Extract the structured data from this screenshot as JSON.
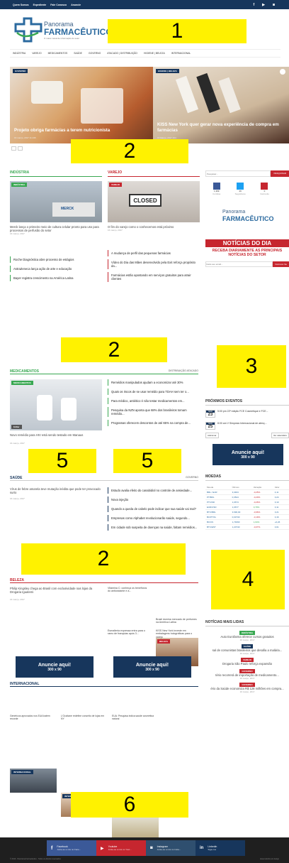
{
  "topbar": {
    "links": [
      "Quem Somos",
      "Expediente",
      "Fale Conosco",
      "Anuncie"
    ]
  },
  "logo": {
    "line1": "Panorama",
    "line2": "FARMACÊUTICO",
    "sub": "O maior canal de informação do setor"
  },
  "callouts": {
    "c1": "1",
    "c2a": "2",
    "c2b": "2",
    "c2c": "2",
    "c3": "3",
    "c4": "4",
    "c5a": "5",
    "c5b": "5",
    "c6": "6"
  },
  "nav": [
    "INDÚSTRIA",
    "VAREJO",
    "MEDICAMENTOS",
    "SAÚDE",
    "GOVERNO",
    "ATACADO | DISTRIBUIÇÃO",
    "HIGIENE | BELEZA",
    "INTERNACIONAL"
  ],
  "hero": {
    "left": {
      "tag": "GOVERNO",
      "title": "Projeto obriga farmácias a terem nutricionista",
      "meta": "16 março, 2017  11.136"
    },
    "right": {
      "tag": "HIGIENE | BELEZA",
      "title": "KISS New York quer gerar nova experiência de compra em farmácias",
      "meta": "15 Março, 2017  404"
    }
  },
  "industria": {
    "title": "INDÚSTRIA",
    "tag": "INDÚSTRIA",
    "img_label": "MERCK",
    "lead": "Merck lança o primeiro meio de cultura celular pronto para uso para processos de perfusão do setor",
    "date": "16 março, 2017",
    "list": [
      "Roche Diagnóstica abre processo de estágios",
      "AstraZeneca lança ação de arte e educação",
      "Bayer registra crescimento na América Latina"
    ]
  },
  "varejo": {
    "title": "VAREJO",
    "tag": "VAREJO",
    "img_label": "CLOSED",
    "lead": "O fim do varejo como o conhecemos está próximo",
    "date": "16 março, 2017",
    "list": [
      "A mudança de perfil das pequenas farmácias",
      "Vídeo do Dia das Mães desenvolvido pela Exit reforça propósito da...",
      "Farmácias estão apostando em serviços gratuitos para atrair clientes"
    ]
  },
  "sidebar": {
    "search_placeholder": "Pesquisar...",
    "search_btn": "PESQUISAR",
    "counts": [
      {
        "n": "1,369",
        "l": "Curtidas"
      },
      {
        "n": "29",
        "l": "Seguidores"
      },
      {
        "n": "0",
        "l": "Inscrevâs"
      }
    ],
    "news_title": "NOTÍCIAS DO DIA",
    "news_sub": "RECEBA DIARIAMENTE AS PRINCIPAIS NOTÍCIAS DO SETOR",
    "email_placeholder": "Insira seu email...",
    "subscribe": "Inscrever-Se"
  },
  "medicamentos": {
    "title": "MEDICAMENTOS",
    "filters": [
      "DISTRIBUIÇÃO",
      "ATACADO"
    ],
    "tag": "MEDICAMENTOS",
    "edit": "Editar",
    "lead": "Novo remédio para HIV está sendo testado em Manaus",
    "date": "16 março, 2017",
    "list": [
      "Remédios manipulados ajudam a economizar até 30%",
      "Quais os riscos de se usar remédio para TDAH sem ter o...",
      "Para médico, antiético é não testar medicamentos em...",
      "Pesquisa da NZN aponta que 68% dos brasileiros tomam remédio...",
      "Programas oferecem descontos de até 65% na compra de..."
    ]
  },
  "eventos": {
    "title": "PRÓXIMOS EVENTOS",
    "items": [
      {
        "month": "MAR",
        "day": "23",
        "text": "5:00 pm 22ª edição FCE Cosmetique e FCE..."
      },
      {
        "month": "MAR",
        "day": "25",
        "text": "8:00 am V Simpósio Internacional de atenç..."
      }
    ],
    "btn_add": "Adicionar",
    "btn_view": "Ver calendário"
  },
  "ad": {
    "text": "Anuncie aqui!",
    "size": "300 x 90"
  },
  "saude": {
    "title": "SAÚDE",
    "filter": "GOVERNO",
    "lead": "Vírus de febre amarela teve mutação inédita que pode ter provocado surto",
    "date": "16 março, 2017",
    "list": [
      "Estudo avalia efeito do canabidiol no controle de ansiedade...",
      "Nova injeção",
      "Quando a queda de cabelo pode indicar que sua saúde vai mal?",
      "Empresas como Alphabet revolucionarão saúde, segundo...",
      "Em cidade sob suspeita de doenças na saúde, faltam remédios..."
    ]
  },
  "moedas": {
    "title": "MOEDAS",
    "headers": [
      "Moeda",
      "Últimos",
      "Variação",
      "Valor"
    ],
    "rows": [
      [
        "BRL / EUR",
        "3,3464",
        "-0,25%",
        "4,11"
      ],
      [
        "PT/BRL",
        "0,3524",
        "-0,20%",
        "0,24"
      ],
      [
        "PT/USD",
        "1,0674",
        "-0,26%",
        "0,10"
      ],
      [
        "EUR/USD",
        "1,0677",
        "0,79%",
        "0,11"
      ],
      [
        "BTC/BRL",
        "3.690,00",
        "-0,96%",
        "3,21"
      ],
      [
        "BC/PT/IG",
        "0,03730",
        "-0,19%",
        "0,16"
      ],
      [
        "BC/US",
        "1,74690",
        "1,64%",
        "+0,26"
      ],
      [
        "BTC/EST",
        "1,20740",
        "-0,07%",
        "0,01"
      ]
    ]
  },
  "beleza": {
    "title": "BELEZA",
    "lead": "Philip Kingsley chega ao Brasil com exclusividade nas lojas da Drogaria Iguatemi",
    "date": "16 março, 2017",
    "mid1": "Vitamina C: conheça os benefícios do antioxidante e a...",
    "tag": "BELEZA",
    "right1": "Brasil domina mercado de perfumes na América Latina",
    "edit": "Editar",
    "mid2": "Esmalteria expressa entra para o ramo de franquias após 3...",
    "right2": "KISS New York investe em embalagens holográficas para o varejo"
  },
  "mais_lidas": {
    "title": "NOTÍCIAS MAIS LIDAS",
    "items": [
      {
        "tag": "INDÚSTRIA",
        "text": "Auto Eurofarma oferece cursos gratuitos",
        "date": "16 março, 2017"
      },
      {
        "tag": "SAÚDE",
        "text": "sal de comunistas brasileiros que desafia a malária...",
        "date": "16 março, 2017"
      },
      {
        "tag": "VAREJO",
        "text": "Drogaria São Paulo reforça expansão",
        "date": ""
      },
      {
        "tag": "GOVERNO",
        "text": "tério recorrerá de importação de medicamento...",
        "date": "16 março, 2017"
      },
      {
        "tag": "GOVERNO",
        "text": "ério da Saúde economiza R$ 128 milhões em compra...",
        "date": "16 março, 2017"
      }
    ]
  },
  "internacional": {
    "title": "INTERNACIONAL",
    "tag": "INTERNACIONAL",
    "items": [
      "Genéricos aprovados nos EUA batem recorde",
      "L'Occitane redefine conceito de lojas em NY",
      "EUA: Pesquisa indica saúde cosmética natural"
    ]
  },
  "footer": {
    "social": [
      {
        "name": "Facebook",
        "sub": "Junte-se a nós no Face..."
      },
      {
        "name": "Youtube",
        "sub": "Junte-se a nós no Yout..."
      },
      {
        "name": "Instagram",
        "sub": "Junte-se a nós no Insta..."
      },
      {
        "name": "Linkedin",
        "sub": "Siga-nos"
      }
    ],
    "copyright": "© 2016 - Panorama Farmacêutico - Todos os direitos reservados",
    "credits": "desenvolvido por design"
  },
  "colors": {
    "navy": "#17365c",
    "green": "#39a852",
    "red": "#c6262f",
    "yellow": "#fff200"
  }
}
